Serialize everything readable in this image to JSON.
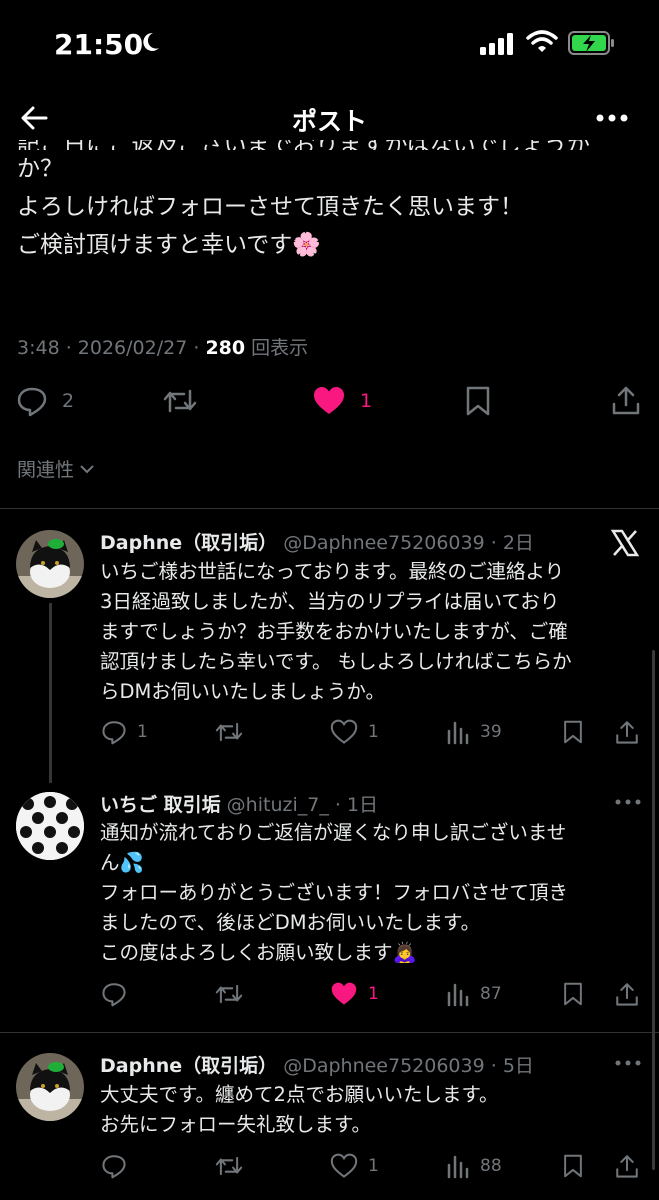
{
  "status": {
    "time": "21:50"
  },
  "header": {
    "title": "ポスト"
  },
  "post": {
    "clipped_line": "記ご日にご返及ございまでおりますかはないでしょうか",
    "lines": [
      "か？",
      "よろしければフォローさせて頂きたく思います！",
      "ご検討頂けますと幸いです🌸"
    ],
    "time": "3:48",
    "date": "2026/02/27",
    "views": "280",
    "views_label": "回表示",
    "replies": "2",
    "likes": "1",
    "related": "関連性"
  },
  "replies": [
    {
      "name": "Daphne（取引垢）",
      "handle": "@Daphnee75206039",
      "age": "2日",
      "lines": [
        "いちご様お世話になっております。最終のご連絡より",
        "3日経過致しましたが、当方のリプライは届いており",
        "ますでしょうか？お手数をおかけいたしますが、ご確",
        "認頂けましたら幸いです。 もしよろしければこちらか",
        "らDMお伺いいたしましょうか。"
      ],
      "replies": "1",
      "likes": "1",
      "views": "39"
    },
    {
      "name": "いちご 取引垢",
      "handle": "@hituzi_7_",
      "age": "1日",
      "lines": [
        "通知が流れておりご返信が遅くなり申し訳ございませ",
        "ん💦",
        "フォローありがとうございます！フォロバさせて頂き",
        "ましたので、後ほどDMお伺いいたします。",
        "この度はよろしくお願い致します🙇‍♀️"
      ],
      "replies": "",
      "likes": "1",
      "views": "87"
    },
    {
      "name": "Daphne（取引垢）",
      "handle": "@Daphnee75206039",
      "age": "5日",
      "lines": [
        "大丈夫です。纏めて2点でお願いいたします。",
        "お先にフォロー失礼致します。"
      ],
      "replies": "",
      "likes": "1",
      "views": "88"
    }
  ],
  "colors": {
    "accent_like": "#f91880",
    "muted": "#71767b",
    "text": "#e7e9ea"
  }
}
